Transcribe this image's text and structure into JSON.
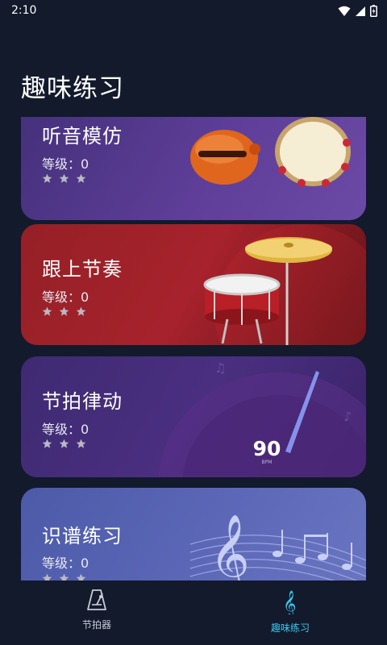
{
  "status_bar": {
    "time": "2:10"
  },
  "page": {
    "title": "趣味练习"
  },
  "cards": [
    {
      "title": "听音模仿",
      "level_label": "等级：",
      "level_value": "0",
      "stars": 3
    },
    {
      "title": "跟上节奏",
      "level_label": "等级：",
      "level_value": "0",
      "stars": 3
    },
    {
      "title": "节拍律动",
      "level_label": "等级：",
      "level_value": "0",
      "stars": 3,
      "tempo_value": "90",
      "tempo_unit": "BPM"
    },
    {
      "title": "识谱练习",
      "level_label": "等级：",
      "level_value": "0",
      "stars": 3
    }
  ],
  "tabbar": {
    "tabs": [
      {
        "label": "节拍器",
        "icon": "metronome-icon",
        "active": false
      },
      {
        "label": "趣味练习",
        "icon": "treble-clef-icon",
        "active": true
      }
    ]
  },
  "colors": {
    "background": "#121a2c",
    "active_tab": "#3cc7f0",
    "inactive_tab": "#c9ccd6"
  }
}
